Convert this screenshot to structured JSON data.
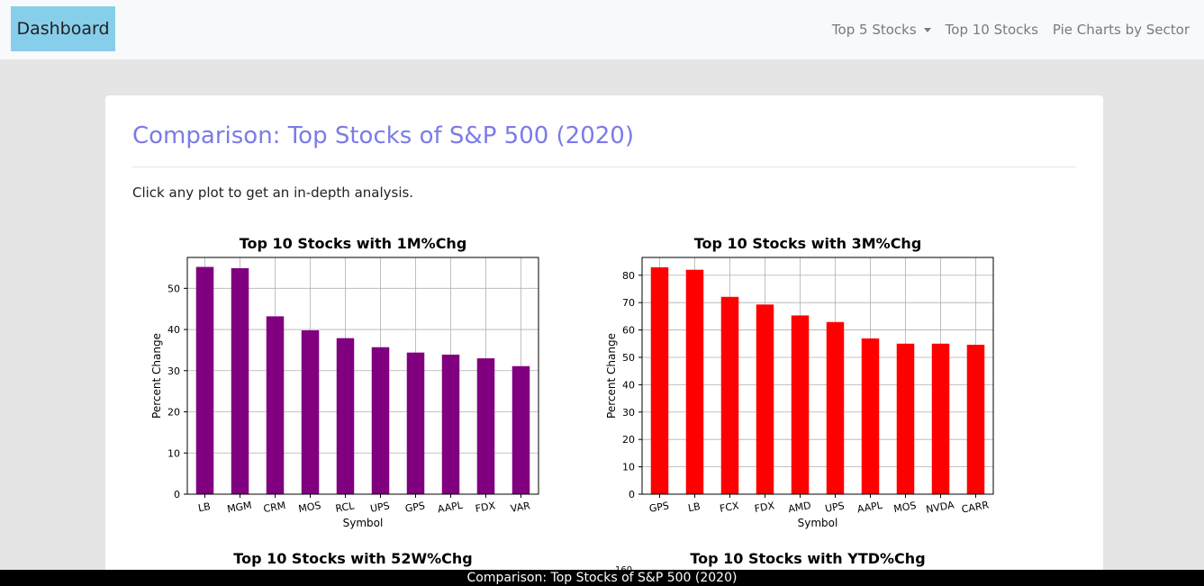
{
  "navbar": {
    "brand": "Dashboard",
    "links": [
      {
        "label": "Top 5 Stocks",
        "dropdown": true
      },
      {
        "label": "Top 10 Stocks",
        "dropdown": false
      },
      {
        "label": "Pie Charts by Sector",
        "dropdown": false
      }
    ]
  },
  "main": {
    "title": "Comparison: Top Stocks of S&P 500 (2020)",
    "intro": "Click any plot to get an in-depth analysis.",
    "lower_plot_titles": [
      "Top 10 Stocks with 52W%Chg",
      "Top 10 Stocks with YTD%Chg"
    ],
    "partial_tick": "160"
  },
  "footer": {
    "caption": "Comparison: Top Stocks of S&P 500 (2020)"
  },
  "colors": {
    "purple_bar": "#800080",
    "red_bar": "#ff0000",
    "title": "#7b7be8",
    "brand_bg": "#87ceeb"
  },
  "chart_data": [
    {
      "type": "bar",
      "title": "Top 10 Stocks with 1M%Chg",
      "xlabel": "Symbol",
      "ylabel": "Percent Change",
      "categories": [
        "LB",
        "MGM",
        "CRM",
        "MOS",
        "RCL",
        "UPS",
        "GPS",
        "AAPL",
        "FDX",
        "VAR"
      ],
      "values": [
        55.2,
        54.9,
        43.2,
        39.8,
        37.9,
        35.7,
        34.4,
        33.9,
        33.0,
        31.1
      ],
      "ylim": [
        0,
        57.5
      ],
      "yticks": [
        0,
        10,
        20,
        30,
        40,
        50
      ],
      "grid": true,
      "color": "#800080"
    },
    {
      "type": "bar",
      "title": "Top 10 Stocks with 3M%Chg",
      "xlabel": "Symbol",
      "ylabel": "Percent Change",
      "categories": [
        "GPS",
        "LB",
        "FCX",
        "FDX",
        "AMD",
        "UPS",
        "AAPL",
        "MOS",
        "NVDA",
        "CARR"
      ],
      "values": [
        82.9,
        82.0,
        72.1,
        69.3,
        65.3,
        62.9,
        56.9,
        55.0,
        55.0,
        54.6
      ],
      "ylim": [
        0,
        86.5
      ],
      "yticks": [
        0,
        10,
        20,
        30,
        40,
        50,
        60,
        70,
        80
      ],
      "grid": true,
      "color": "#ff0000"
    }
  ]
}
